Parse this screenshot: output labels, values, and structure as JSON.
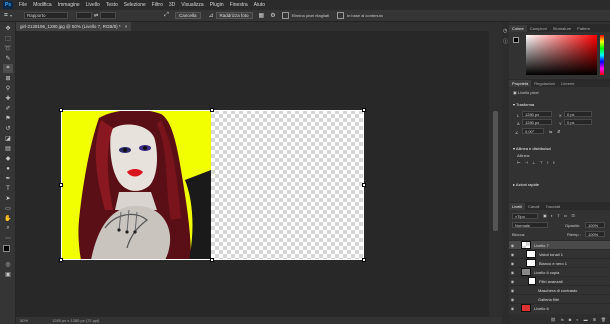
{
  "menu": {
    "logo": "Ps",
    "items": [
      "File",
      "Modifica",
      "Immagine",
      "Livello",
      "Testo",
      "Selezione",
      "Filtro",
      "3D",
      "Visualizza",
      "Plugin",
      "Finestra",
      "Aiuto"
    ]
  },
  "options": {
    "style_value": "Rapporto",
    "straighten_label": "Cancella",
    "ratio_label": "Raddrizza foto",
    "delete_pixels_label": "Elimina pixel ritagliati",
    "content_aware_label": "In base al contenuto"
  },
  "document": {
    "tab_title": "girl-2128196_1280.jpg @ 50% (Livello 7, RGB/8) *",
    "close_glyph": "×",
    "status_zoom": "50%",
    "status_dims": "1280 px x 1280 px (72 ppi)"
  },
  "panels": {
    "color_tabs": [
      "Colore",
      "Campioni",
      "Sfumature",
      "Pattern"
    ],
    "properties_tabs": [
      "Proprietà",
      "Regolazioni",
      "Librerie"
    ],
    "pixel_layer_label": "Livello pixel",
    "transform": {
      "title": "Trasforma",
      "w_label": "L",
      "w_value": "1280 px",
      "h_label": "A",
      "h_value": "1280 px",
      "x_label": "X",
      "x_value": "0 px",
      "y_label": "Y",
      "y_value": "0 px",
      "angle_value": "0,00°"
    },
    "align_title": "Allinea e distribuisci",
    "align_sub": "Allinea:",
    "quick_actions_title": "Azioni rapide",
    "layers_tabs": [
      "Livelli",
      "Canali",
      "Tracciati"
    ],
    "filter_kind": "Tipo",
    "blend_mode": "Normale",
    "opacity_label": "Opacità:",
    "opacity_value": "100%",
    "lock_label": "Blocca:",
    "fill_label": "Riemp.:",
    "fill_value": "100%",
    "layers": [
      {
        "name": "Livello 7"
      },
      {
        "name": "Valori tonali 1"
      },
      {
        "name": "Bianco e nero 1"
      },
      {
        "name": "Livello 6 copia"
      },
      {
        "name": "Filtri avanzati"
      },
      {
        "name": "Maschera di contrasto"
      },
      {
        "name": "Galleria filtri"
      },
      {
        "name": "Livello 6"
      }
    ]
  },
  "colors": {
    "yellow": "#f2ff00",
    "accent": "#31a8ff"
  }
}
